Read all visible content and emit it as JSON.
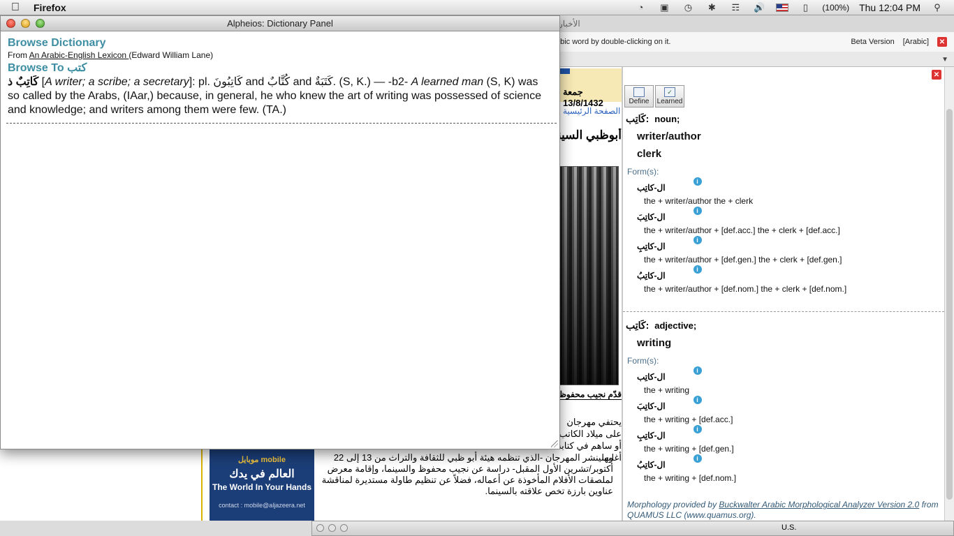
{
  "menubar": {
    "app_name": "Firefox",
    "battery": "(100%)",
    "clock": "Thu 12:04 PM"
  },
  "firefox": {
    "tab_text": "الأخبار",
    "notification": "abic word by double-clicking on it.",
    "beta": "Beta Version",
    "language": "[Arabic]"
  },
  "page": {
    "date": "جمعة 13/8/1432",
    "home_link": "الصفحة الرئيسية",
    "headline": "أبوظبي السينمائي",
    "photo_caption": "قدّم نجيب محفوظ",
    "article_lines": [
      "يحتفي مهرجان",
      "على ميلاد الكاتب",
      "أو ساهم في كتابة",
      "أغلبها."
    ],
    "article2": "وسينشر المهرجان -الذي تنظمه هيئة أبو ظبي للثقافة والتراث من 13 إلى 22 أكتوبر/تشرين الأول المقبل- دراسة عن نجيب محفوظ والسينما، وإقامة معرض لملصقات الأفلام المأخوذة عن أعماله، فضلاً عن تنظيم طاولة مستديرة لمناقشة عناوين بارزة تخص علاقته بالسينما.",
    "ad": {
      "brand": "موبايل mobile",
      "arabic": "العالم في يدك",
      "tagline": "The World In Your Hands",
      "contact": "contact : mobile@aljazeera.net"
    }
  },
  "sidebar": {
    "toolbar": {
      "define": "Define",
      "learned": "Learned"
    },
    "entries": [
      {
        "lemma": "كَاتِب:",
        "pos": "noun;",
        "senses": [
          "writer/author",
          "clerk"
        ],
        "forms_label": "Form(s):",
        "forms": [
          {
            "word": "ال-كاتِب",
            "gloss": "the + writer/author  the + clerk"
          },
          {
            "word": "ال-كاتِبَ",
            "gloss": "the + writer/author + [def.acc.]  the + clerk + [def.acc.]"
          },
          {
            "word": "ال-كاتِبِ",
            "gloss": "the + writer/author + [def.gen.]  the + clerk + [def.gen.]"
          },
          {
            "word": "ال-كاتِبُ",
            "gloss": "the + writer/author + [def.nom.]  the + clerk + [def.nom.]"
          }
        ]
      },
      {
        "lemma": "كَاتِب:",
        "pos": "adjective;",
        "senses": [
          "writing"
        ],
        "forms_label": "Form(s):",
        "forms": [
          {
            "word": "ال-كاتِب",
            "gloss": "the + writing"
          },
          {
            "word": "ال-كاتِبَ",
            "gloss": "the + writing + [def.acc.]"
          },
          {
            "word": "ال-كاتِبِ",
            "gloss": "the + writing + [def.gen.]"
          },
          {
            "word": "ال-كاتِبُ",
            "gloss": "the + writing + [def.nom.]"
          }
        ]
      }
    ],
    "credit_prefix": "Morphology provided by ",
    "credit_link": "Buckwalter Arabic Morphological Analyzer Version 2.0",
    "credit_suffix": " from QUAMUS LLC (www.quamus.org)."
  },
  "mini_window": {
    "label": "U.S."
  },
  "dictionary_panel": {
    "window_title": "Alpheios: Dictionary Panel",
    "browse_title": "Browse Dictionary",
    "from_prefix": "From ",
    "lexicon": "An Arabic-English Lexicon ",
    "lexicon_author": "(Edward William Lane)",
    "browse_to_label": "Browse To",
    "browse_to_word": "كتب",
    "headword": "كَاتِبٌ ذ",
    "gloss_italic": "A writer; a scribe; a secretary",
    "def_part1": ": pl. ",
    "plural1": "كَاتِبُونَ",
    "and1": " and ",
    "plural2": "كُتَّابٌ",
    "and2": " and ",
    "plural3": "كَتَبَةٌ",
    "def_part2": ". (S, K.) — -b2- ",
    "learned_italic": "A learned man",
    "def_part3": " (S, K) was so called by the Arabs, (IAar,) because, in general, he who knew the art of writing was possessed of science and knowledge; and writers among them were few. (TA.)"
  },
  "colors": {
    "accent_teal": "#3d8ea3",
    "ad_blue": "#1c3e78",
    "gold": "#d9b200",
    "close_red": "#dd3333"
  }
}
